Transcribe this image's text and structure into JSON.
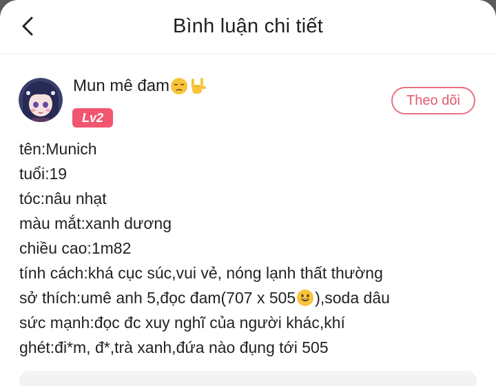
{
  "header": {
    "title": "Bình luận chi tiết"
  },
  "user": {
    "name": "Mun mê đam",
    "name_emojis": [
      "pensive-face-emoji",
      "love-you-gesture-emoji"
    ],
    "level": "Lv2",
    "follow_label": "Theo dõi"
  },
  "comment": {
    "lines": [
      "tên:Munich",
      "tuổi:19",
      "tóc:nâu nhạt",
      "màu mắt:xanh dương",
      "chiều cao:1m82",
      "tính cách:khá cục súc,vui vẻ, nóng lạnh thất thường",
      {
        "before": "sở thích:umê anh 5,đọc đam(707 x 505",
        "emoji": "grinning-face-emoji",
        "after": "),soda dâu"
      },
      "sức mạnh:đọc đc xuy nghĩ của người khác,khí",
      "ghét:đi*m, đ*,trà xanh,đứa nào đụng tới 505"
    ]
  },
  "colors": {
    "accent": "#f2556f",
    "follow_border": "#ea6f82",
    "text": "#222222"
  }
}
